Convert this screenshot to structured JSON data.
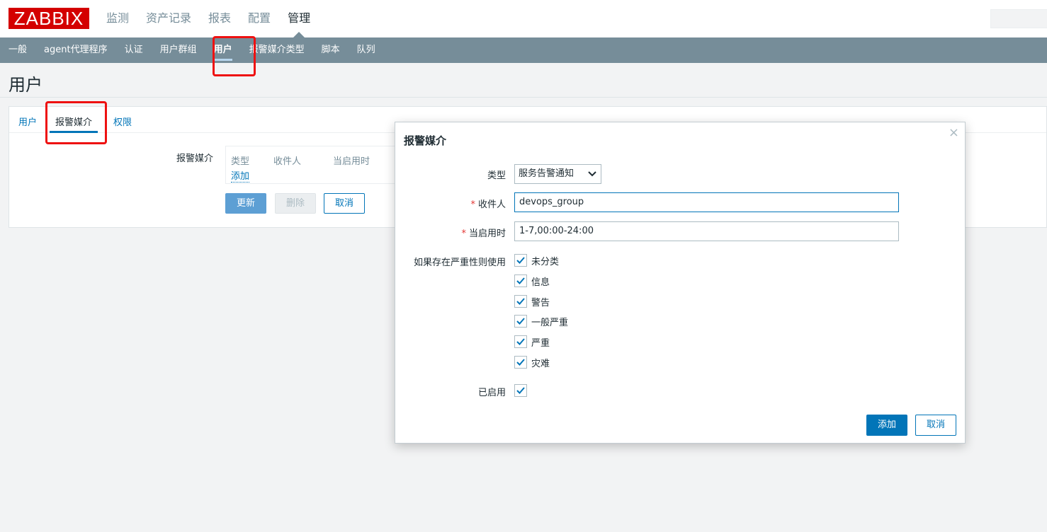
{
  "header": {
    "logo": "ZABBIX",
    "main_nav": [
      "监测",
      "资产记录",
      "报表",
      "配置",
      "管理"
    ],
    "active_main": "管理"
  },
  "subnav": {
    "items": [
      "一般",
      "agent代理程序",
      "认证",
      "用户群组",
      "用户",
      "报警媒介类型",
      "脚本",
      "队列"
    ],
    "active": "用户"
  },
  "page": {
    "title": "用户"
  },
  "form": {
    "tabs": [
      "用户",
      "报警媒介",
      "权限"
    ],
    "active_tab": "报警媒介",
    "media_label": "报警媒介",
    "media_table": {
      "columns": [
        "类型",
        "收件人",
        "当启用时"
      ],
      "add_link": "添加"
    },
    "buttons": {
      "update": "更新",
      "delete": "删除",
      "cancel": "取消"
    }
  },
  "dialog": {
    "title": "报警媒介",
    "close_icon": "close-icon",
    "type_label": "类型",
    "type_value": "服务告警通知",
    "sendto_label": "收件人",
    "sendto_value": "devops_group",
    "period_label": "当启用时",
    "period_value": "1-7,00:00-24:00",
    "severity_label": "如果存在严重性则使用",
    "severities": [
      {
        "label": "未分类",
        "checked": true
      },
      {
        "label": "信息",
        "checked": true
      },
      {
        "label": "警告",
        "checked": true
      },
      {
        "label": "一般严重",
        "checked": true
      },
      {
        "label": "严重",
        "checked": true
      },
      {
        "label": "灾难",
        "checked": true
      }
    ],
    "enabled_label": "已启用",
    "enabled_checked": true,
    "add_button": "添加",
    "cancel_button": "取消"
  },
  "colors": {
    "subnav_bg": "#768d99",
    "link": "#0275b8",
    "logo_bg": "#d40000",
    "highlight": "#ee1111"
  }
}
